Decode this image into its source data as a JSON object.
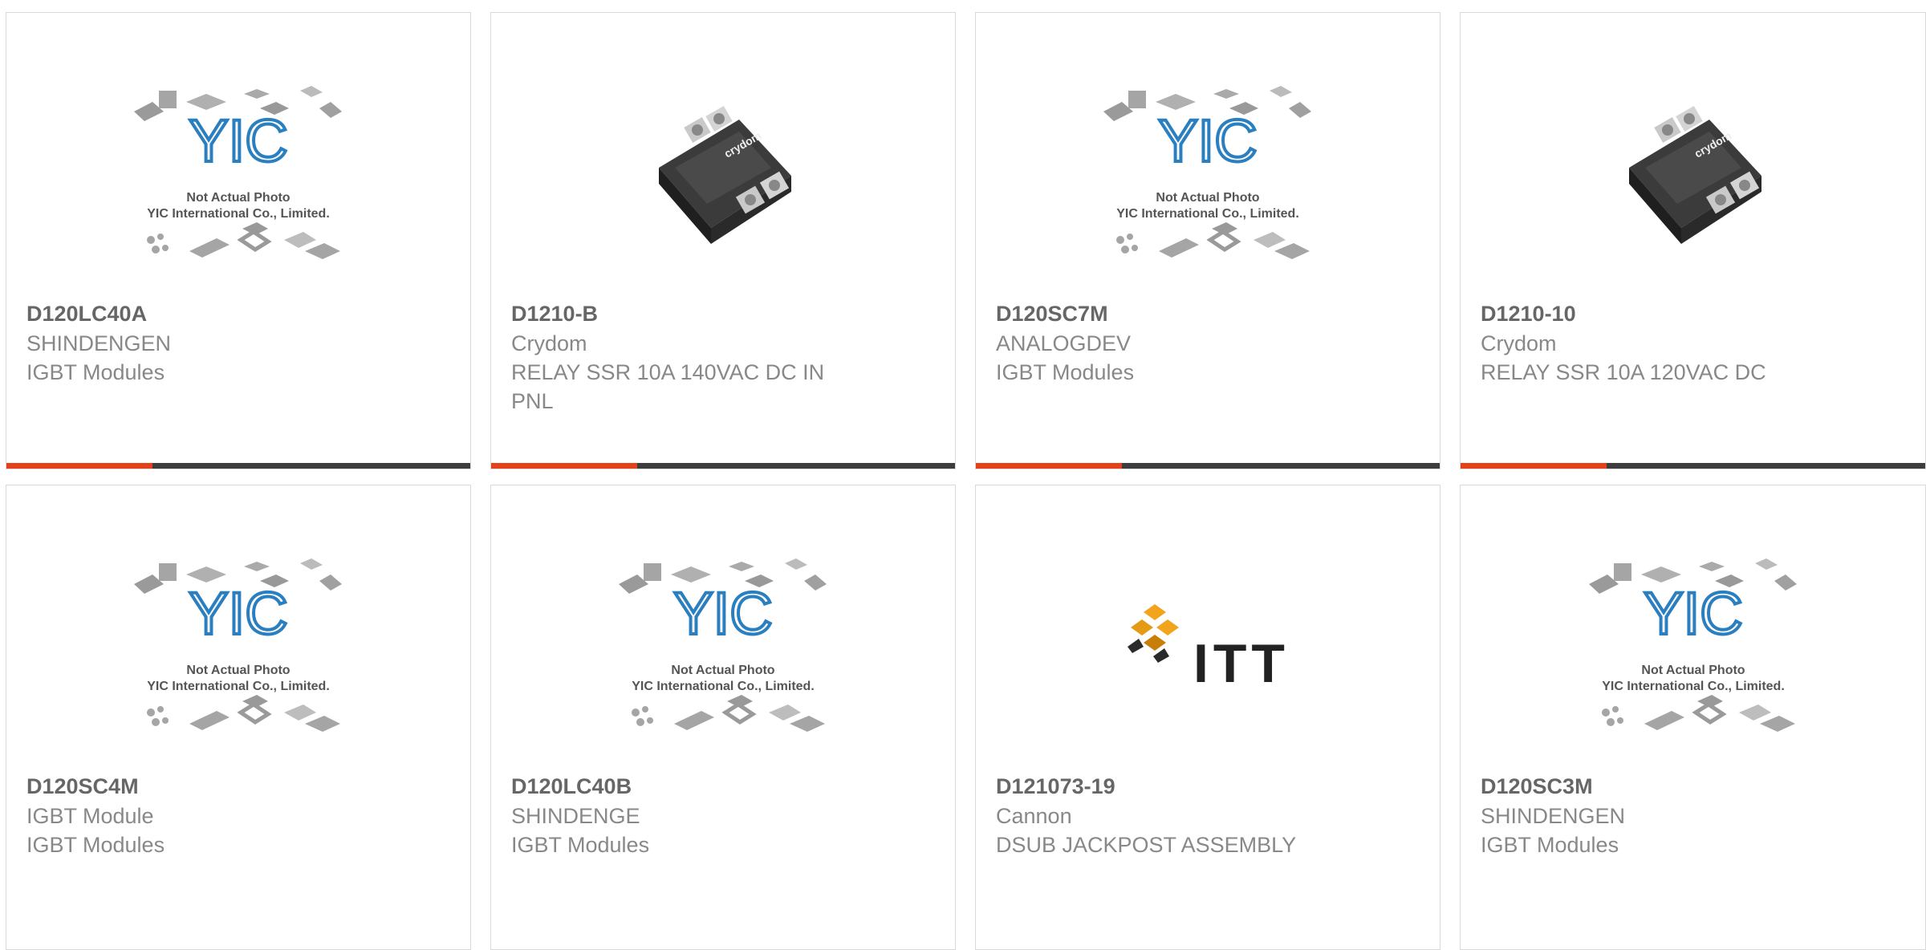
{
  "colors": {
    "accent": "#e4411a",
    "bar_dark": "#3d3d3d",
    "logo_blue": "#2a7fc1",
    "itt_orange": "#f2a51c"
  },
  "placeholder": {
    "logo_text": "YIC",
    "line1": "Not Actual Photo",
    "line2": "YIC International Co., Limited."
  },
  "itt_logo": {
    "text": "ITT"
  },
  "crydom_logo": {
    "text": "crydom"
  },
  "products": [
    {
      "part": "D120LC40A",
      "manufacturer": "SHINDENGEN",
      "description": "IGBT Modules",
      "image": "placeholder"
    },
    {
      "part": "D1210-B",
      "manufacturer": "Crydom",
      "description": "RELAY SSR 10A 140VAC DC IN PNL",
      "image": "relay"
    },
    {
      "part": "D120SC7M",
      "manufacturer": "ANALOGDEV",
      "description": "IGBT Modules",
      "image": "placeholder"
    },
    {
      "part": "D1210-10",
      "manufacturer": "Crydom",
      "description": "RELAY SSR 10A 120VAC DC",
      "image": "relay"
    },
    {
      "part": "D120SC4M",
      "manufacturer": "IGBT Module",
      "description": "IGBT Modules",
      "image": "placeholder"
    },
    {
      "part": "D120LC40B",
      "manufacturer": "SHINDENGE",
      "description": "IGBT Modules",
      "image": "placeholder"
    },
    {
      "part": "D121073-19",
      "manufacturer": "Cannon",
      "description": "DSUB JACKPOST ASSEMBLY",
      "image": "itt"
    },
    {
      "part": "D120SC3M",
      "manufacturer": "SHINDENGEN",
      "description": "IGBT Modules",
      "image": "placeholder"
    }
  ]
}
